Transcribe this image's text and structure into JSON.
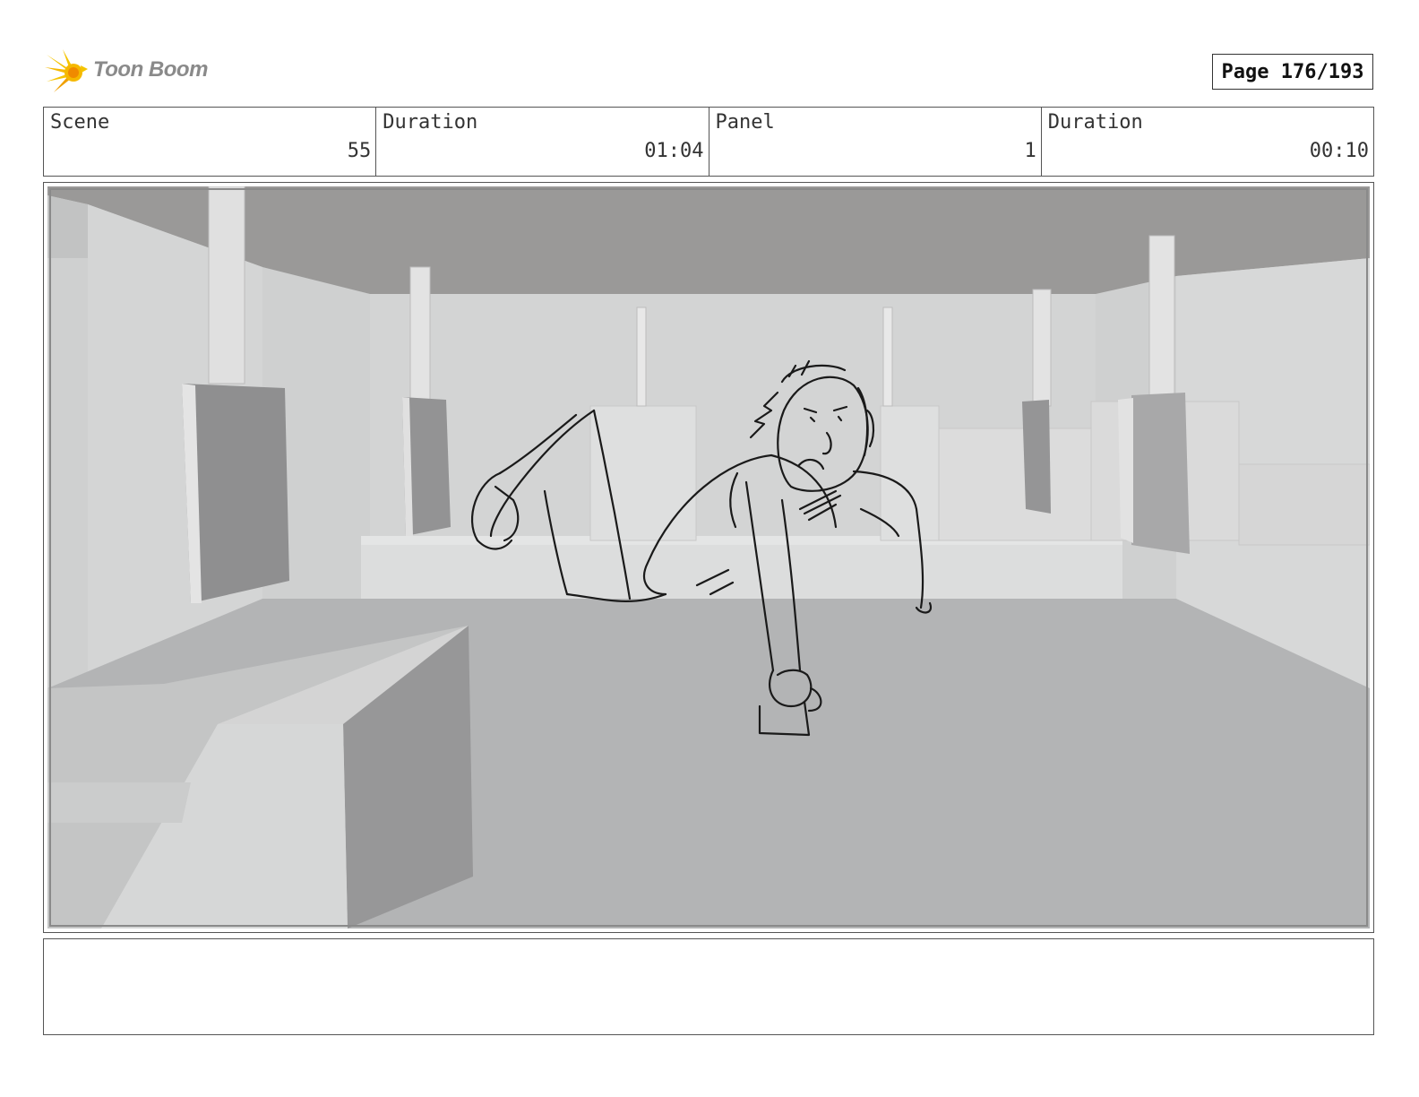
{
  "header": {
    "logo_text": "Toon Boom",
    "page_indicator": "Page 176/193"
  },
  "info": {
    "scene_label": "Scene",
    "scene_value": "55",
    "scene_duration_label": "Duration",
    "scene_duration_value": "01:04",
    "panel_label": "Panel",
    "panel_value": "1",
    "panel_duration_label": "Duration",
    "panel_duration_value": "00:10"
  },
  "panel": {
    "image_content": "grey 3D room with sketched character"
  },
  "notes": {
    "text": ""
  },
  "colors": {
    "logo_yellow": "#f5c400",
    "logo_orange": "#f08a00",
    "logo_text": "#8a8a8a",
    "border": "#555555"
  },
  "icons": [
    "toon-boom-logo-icon"
  ]
}
